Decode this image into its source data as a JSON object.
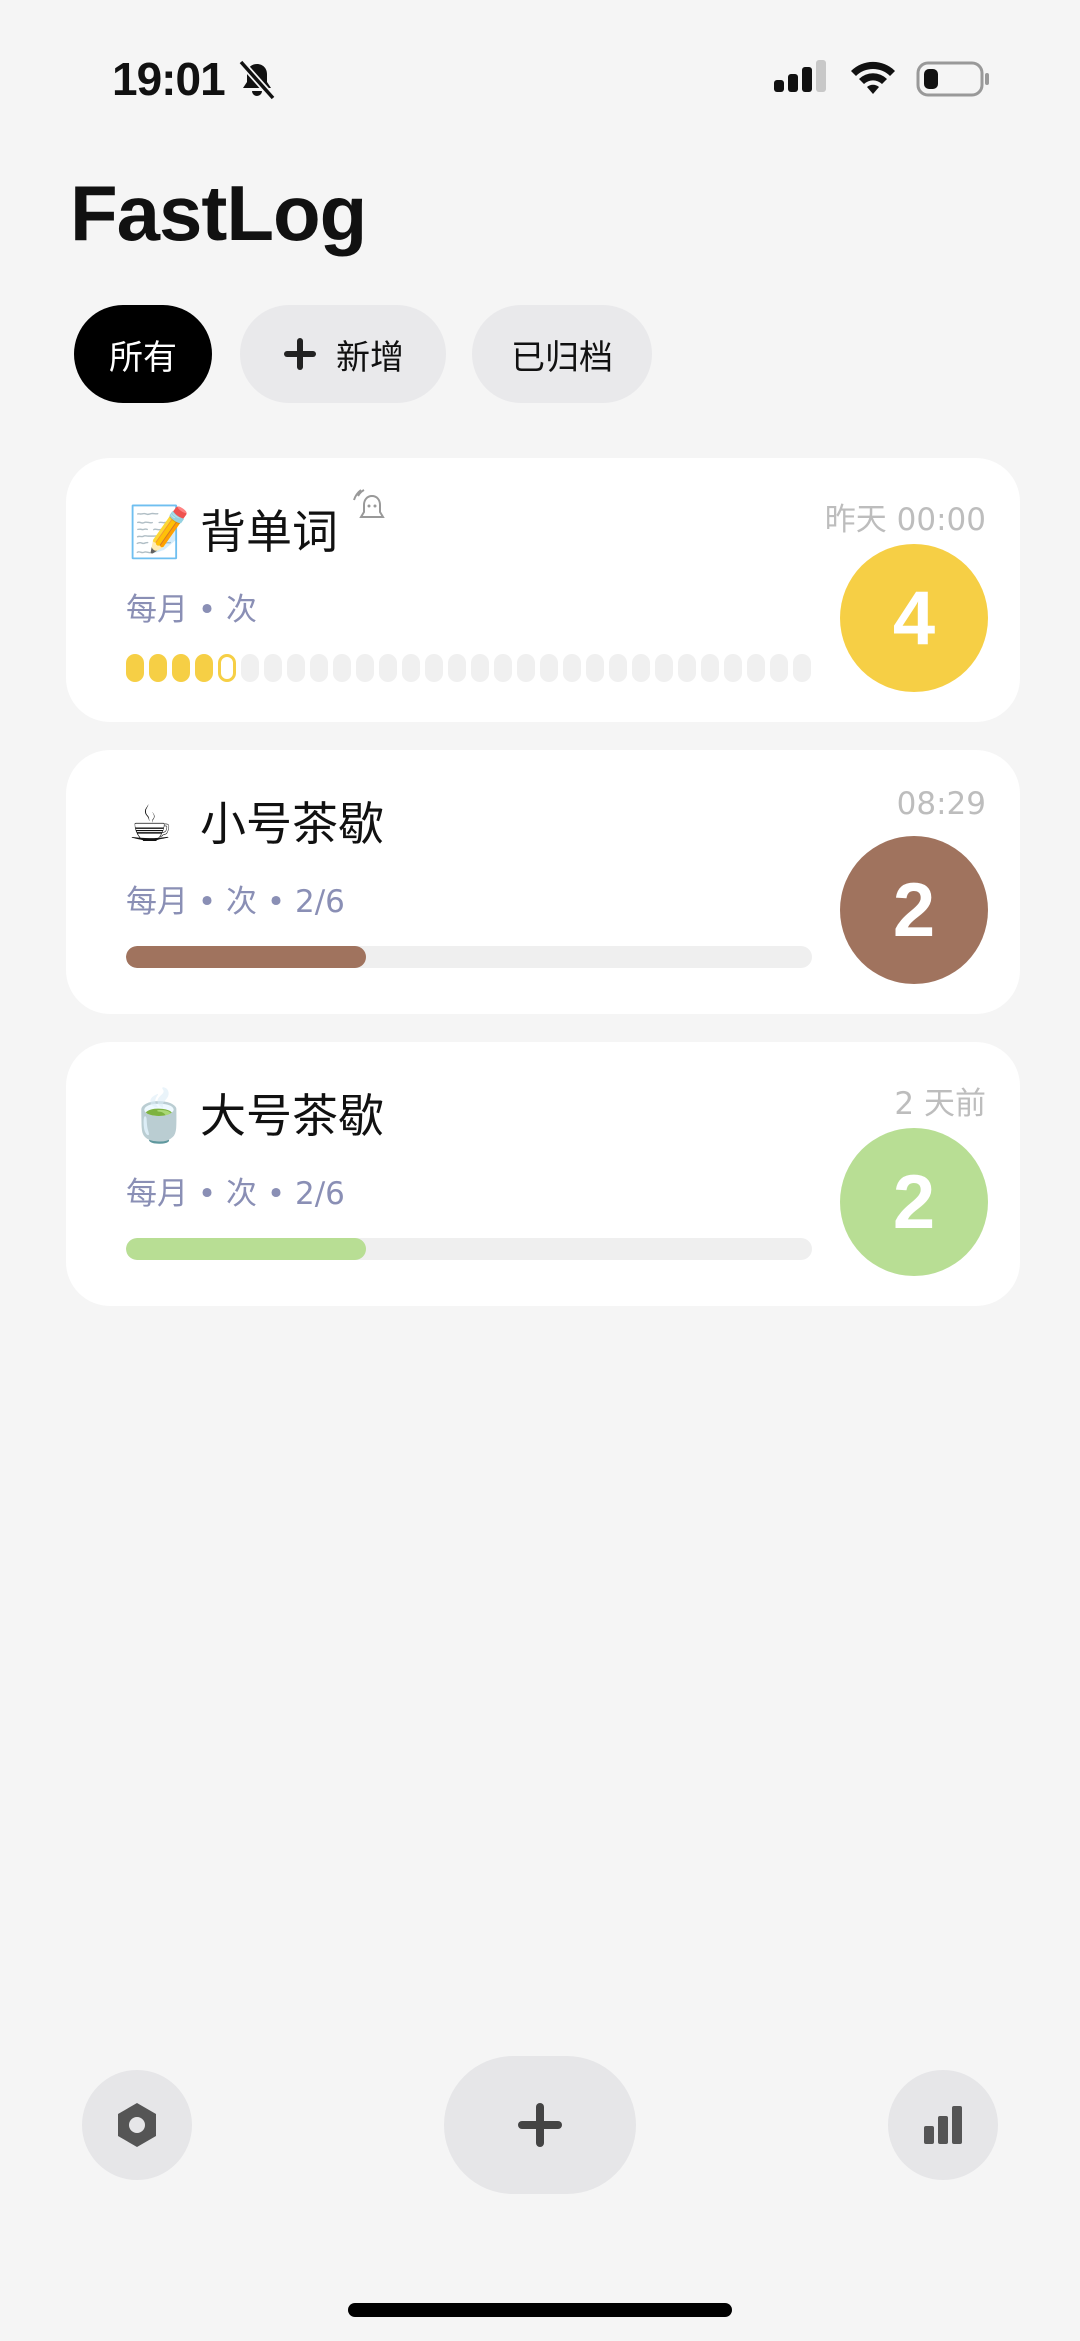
{
  "status_bar": {
    "time": "19:01",
    "icons": [
      "bell-slash-icon",
      "signal-icon",
      "wifi-icon",
      "battery-icon"
    ]
  },
  "app": {
    "title": "FastLog"
  },
  "filters": [
    {
      "label": "所有",
      "active": true
    },
    {
      "label": "新增",
      "icon": "plus-icon",
      "active": false
    },
    {
      "label": "已归档",
      "active": false
    }
  ],
  "items": [
    {
      "emoji": "📝",
      "title": "背单词",
      "reminder_icon": "alarm-reminder-icon",
      "subtitle": "每月 • 次",
      "time": "昨天 00:00",
      "count": "4",
      "color": "#f6cf45",
      "progress_type": "dots",
      "dots_filled": 4,
      "dots_current": 1,
      "dots_total": 30
    },
    {
      "emoji": "☕",
      "title": "小号茶歇",
      "subtitle": "每月 • 次 • 2/6",
      "time": "08:29",
      "count": "2",
      "color": "#a0735e",
      "progress_type": "bar",
      "progress": 0.35
    },
    {
      "emoji": "🍵",
      "title": "大号茶歇",
      "subtitle": "每月 • 次 • 2/6",
      "time": "2 天前",
      "count": "2",
      "color": "#b8de94",
      "progress_type": "bar",
      "progress": 0.35
    }
  ],
  "bottom_bar": {
    "left_icon": "settings-hexagon-icon",
    "center_icon": "plus-icon",
    "right_icon": "bar-chart-icon"
  }
}
